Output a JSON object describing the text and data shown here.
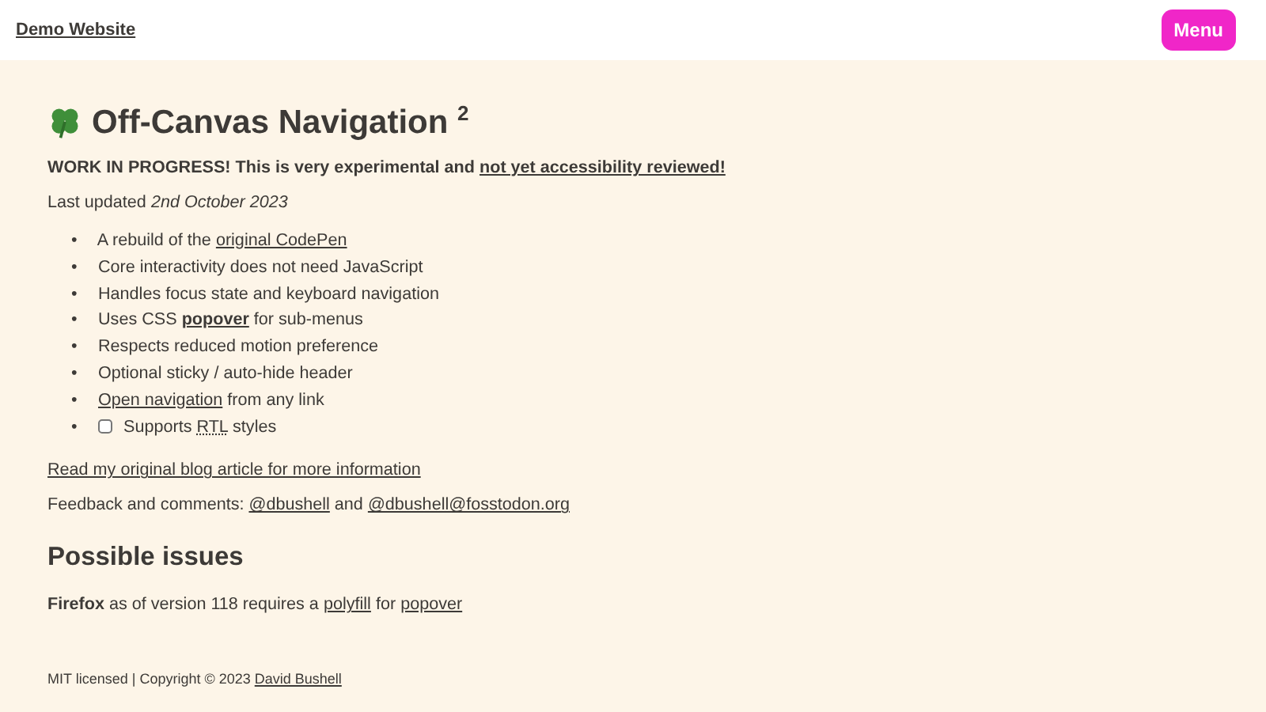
{
  "header": {
    "site_title": "Demo Website",
    "menu_button": "Menu"
  },
  "heading": "Off-Canvas Navigation $^{2}$",
  "notice": [
    {
      "kind": "text",
      "text": "WORK IN PROGRESS! This is very experimental and "
    },
    {
      "kind": "link",
      "text": "not yet accessibility reviewed!"
    }
  ],
  "updated": [
    {
      "kind": "text",
      "text": "Last updated "
    },
    {
      "kind": "italic",
      "text": "2nd October 2023"
    }
  ],
  "bullet": "•",
  "features": [
    {
      "kind": "text",
      "parts": [
        {
          "kind": "text",
          "text": "A rebuild of the "
        },
        {
          "kind": "link",
          "text": "original CodePen"
        }
      ]
    },
    {
      "kind": "text",
      "parts": [
        {
          "kind": "text",
          "text": "Core interactivity does not need JavaScript"
        }
      ]
    },
    {
      "kind": "text",
      "parts": [
        {
          "kind": "text",
          "text": "Handles focus state and keyboard navigation"
        }
      ]
    },
    {
      "kind": "text",
      "parts": [
        {
          "kind": "text",
          "text": "Uses CSS "
        },
        {
          "kind": "bold-link",
          "text": "popover"
        },
        {
          "kind": "text",
          "text": " for sub-menus"
        }
      ]
    },
    {
      "kind": "text",
      "parts": [
        {
          "kind": "text",
          "text": "Respects reduced motion preference"
        }
      ]
    },
    {
      "kind": "text",
      "parts": [
        {
          "kind": "text",
          "text": "Optional sticky / auto-hide header"
        }
      ]
    },
    {
      "kind": "text",
      "parts": [
        {
          "kind": "link",
          "text": "Open navigation"
        },
        {
          "kind": "text",
          "text": " from any link"
        }
      ]
    },
    {
      "kind": "checkbox",
      "checked": false,
      "parts": [
        {
          "kind": "text",
          "text": "Supports "
        },
        {
          "kind": "abbr",
          "text": "RTL"
        },
        {
          "kind": "text",
          "text": " styles"
        }
      ]
    }
  ],
  "blog_link": "Read my original blog article for more information",
  "feedback": [
    {
      "kind": "text",
      "text": "Feedback and comments: "
    },
    {
      "kind": "link",
      "text": "@dbushell"
    },
    {
      "kind": "text",
      "text": " and "
    },
    {
      "kind": "link",
      "text": "@dbushell@fosstodon.org"
    }
  ],
  "issues_heading": "Possible issues",
  "issues": [
    {
      "kind": "bold",
      "text": "Firefox"
    },
    {
      "kind": "text",
      "text": " as of version 118 requires a "
    },
    {
      "kind": "link",
      "text": "polyfill"
    },
    {
      "kind": "text",
      "text": " for "
    },
    {
      "kind": "link",
      "text": "popover"
    }
  ],
  "footer": [
    {
      "kind": "text",
      "text": "MIT licensed | Copyright © 2023 "
    },
    {
      "kind": "link",
      "text": "David Bushell"
    }
  ]
}
